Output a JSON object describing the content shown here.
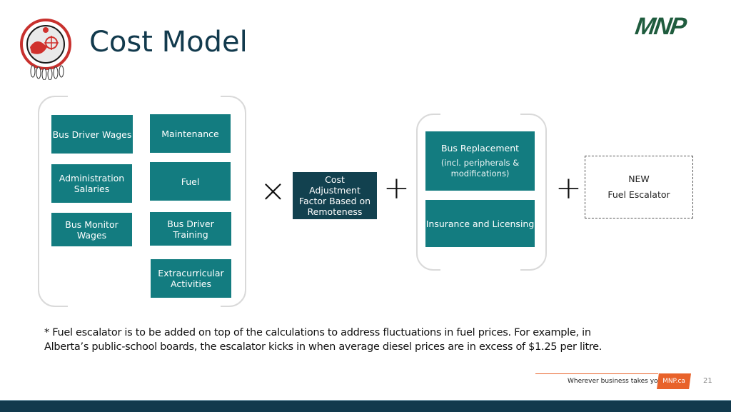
{
  "header": {
    "title": "Cost Model",
    "logo_left": "assembly-of-first-nations-logo",
    "logo_right": "MNP"
  },
  "group_operating_costs": {
    "items": [
      {
        "label": "Bus Driver Wages"
      },
      {
        "label": "Maintenance"
      },
      {
        "label": "Administration Salaries"
      },
      {
        "label": "Fuel"
      },
      {
        "label": "Bus Monitor Wages"
      },
      {
        "label": "Bus Driver Training"
      },
      {
        "label": "Extracurricular Activities"
      }
    ]
  },
  "operators": {
    "multiply": "×",
    "plus1": "+",
    "plus2": "+"
  },
  "adjustment": {
    "label": "Cost Adjustment Factor Based on Remoteness"
  },
  "group_capital_costs": {
    "items": [
      {
        "label": "Bus Replacement",
        "sublabel": "(incl. peripherals & modifications)"
      },
      {
        "label": "Insurance and Licensing"
      }
    ]
  },
  "new_item": {
    "line1": "NEW",
    "line2": "Fuel Escalator"
  },
  "footnote": "* Fuel escalator is to be added on top of the calculations to address fluctuations in fuel prices. For example, in Alberta’s public-school boards, the escalator kicks in when average diesel prices are in excess of $1.25 per litre.",
  "footer": {
    "tagline": "Wherever business takes you",
    "badge": "MNP.ca",
    "page_number": "21"
  },
  "colors": {
    "teal": "#137c80",
    "dark_teal": "#12414f",
    "title": "#123a4d",
    "accent_orange": "#e8622a",
    "mnp_green": "#1f5c3e"
  }
}
